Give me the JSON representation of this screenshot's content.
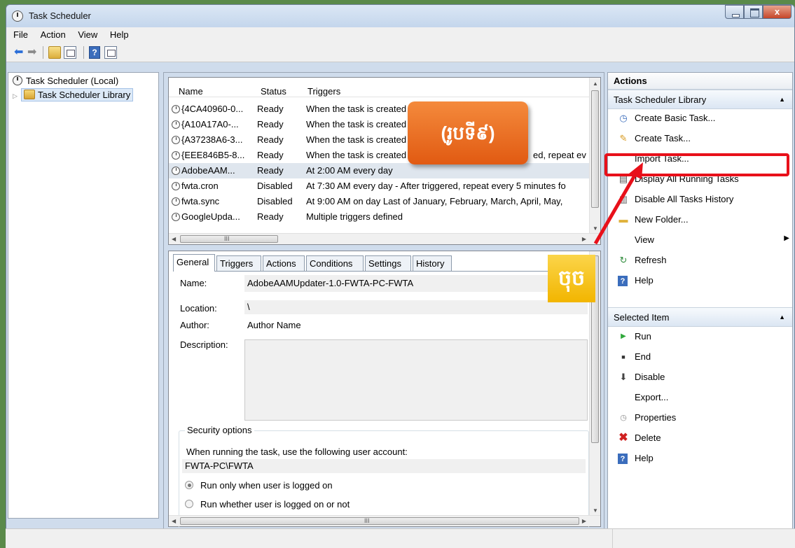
{
  "window": {
    "title": "Task Scheduler",
    "close_glyph": "x"
  },
  "menu": [
    "File",
    "Action",
    "View",
    "Help"
  ],
  "tree": {
    "root": "Task Scheduler (Local)",
    "library": "Task Scheduler Library"
  },
  "task_list": {
    "headers": {
      "name": "Name",
      "status": "Status",
      "triggers": "Triggers"
    },
    "rows": [
      {
        "name": "{4CA40960-0...",
        "status": "Ready",
        "triggers": "When the task is created"
      },
      {
        "name": "{A10A17A0-...",
        "status": "Ready",
        "triggers": "When the task is created"
      },
      {
        "name": "{A37238A6-3...",
        "status": "Ready",
        "triggers": "When the task is created"
      },
      {
        "name": "{EEE846B5-8...",
        "status": "Ready",
        "triggers": "When the task is created"
      },
      {
        "name": "AdobeAAM...",
        "status": "Ready",
        "triggers": "At 2:00 AM every day"
      },
      {
        "name": "fwta.cron",
        "status": "Disabled",
        "triggers": "At 7:30 AM every day - After triggered, repeat every 5 minutes fo"
      },
      {
        "name": "fwta.sync",
        "status": "Disabled",
        "triggers": "At 9:00 AM  on day Last of January, February, March, April, May,"
      },
      {
        "name": "GoogleUpda...",
        "status": "Ready",
        "triggers": "Multiple triggers defined"
      }
    ],
    "row4_trigger_tail": "ed, repeat ev",
    "hscroll_glyph": "III"
  },
  "details": {
    "tabs": [
      "General",
      "Triggers",
      "Actions",
      "Conditions",
      "Settings",
      "History"
    ],
    "name_label": "Name:",
    "name_value": "AdobeAAMUpdater-1.0-FWTA-PC-FWTA",
    "location_label": "Location:",
    "location_value": "\\",
    "author_label": "Author:",
    "author_value": "Author Name",
    "description_label": "Description:",
    "security_title": "Security options",
    "security_text": "When running the task, use the following user account:",
    "account": "FWTA-PC\\FWTA",
    "radio1": "Run only when user is logged on",
    "radio2": "Run whether user is logged on or not",
    "hscroll_glyph": "III"
  },
  "actions": {
    "header": "Actions",
    "section1": "Task Scheduler Library",
    "items1": [
      {
        "label": "Create Basic Task...",
        "icon": "calendar-icon"
      },
      {
        "label": "Create Task...",
        "icon": "new-task-icon"
      },
      {
        "label": "Import Task...",
        "icon": ""
      },
      {
        "label": "Display All Running Tasks",
        "icon": "running-tasks-icon"
      },
      {
        "label": "Disable All Tasks History",
        "icon": "history-icon"
      },
      {
        "label": "New Folder...",
        "icon": "folder-icon"
      },
      {
        "label": "View",
        "icon": ""
      },
      {
        "label": "Refresh",
        "icon": "refresh-icon"
      },
      {
        "label": "Help",
        "icon": "help-icon"
      }
    ],
    "section2": "Selected Item",
    "items2": [
      {
        "label": "Run",
        "icon": "run-icon"
      },
      {
        "label": "End",
        "icon": "end-icon"
      },
      {
        "label": "Disable",
        "icon": "disable-icon"
      },
      {
        "label": "Export...",
        "icon": ""
      },
      {
        "label": "Properties",
        "icon": "properties-icon"
      },
      {
        "label": "Delete",
        "icon": "delete-icon"
      },
      {
        "label": "Help",
        "icon": "help-icon"
      }
    ]
  },
  "annotations": {
    "step_label": "(រូបទី៩)",
    "click_label": "ចុច"
  },
  "colors": {
    "highlight": "#e8101a",
    "badge_orange": "#e8641e",
    "badge_yellow": "#f5c21b"
  }
}
